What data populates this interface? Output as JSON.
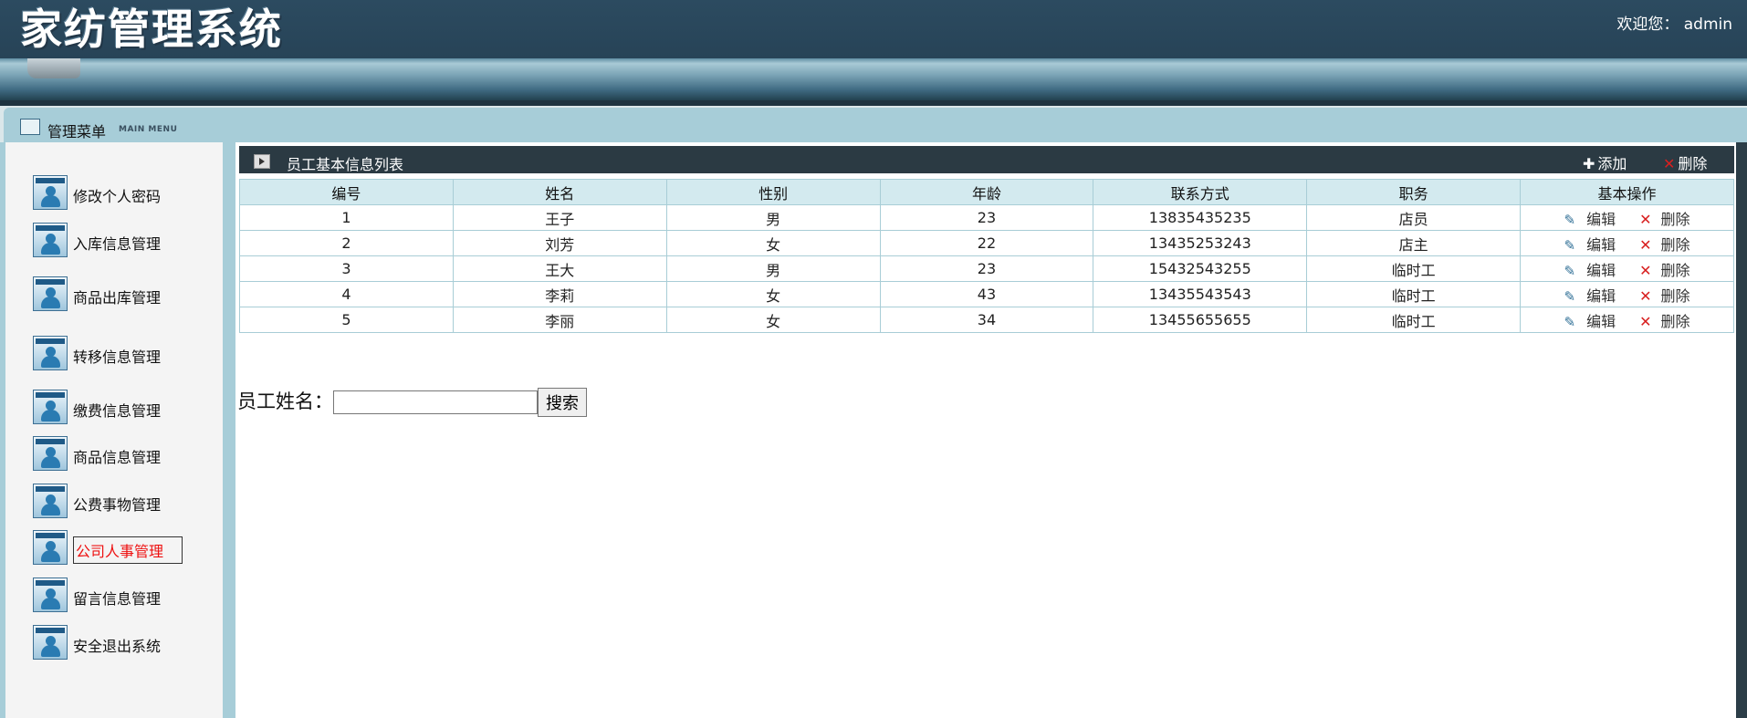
{
  "header": {
    "title": "家纺管理系统",
    "welcome": "欢迎您： admin"
  },
  "menu": {
    "title": "管理菜单",
    "subtitle": "MAIN MENU"
  },
  "sidebar": {
    "items": [
      {
        "label": "修改个人密码"
      },
      {
        "label": "入库信息管理"
      },
      {
        "label": "商品出库管理"
      },
      {
        "label": "转移信息管理"
      },
      {
        "label": "缴费信息管理"
      },
      {
        "label": "商品信息管理"
      },
      {
        "label": "公费事物管理"
      },
      {
        "label": "公司人事管理",
        "active": true
      },
      {
        "label": "留言信息管理"
      },
      {
        "label": "安全退出系统"
      }
    ]
  },
  "panel": {
    "title": "员工基本信息列表",
    "add_label": "添加",
    "delete_label": "删除"
  },
  "table": {
    "columns": [
      "编号",
      "姓名",
      "性别",
      "年龄",
      "联系方式",
      "职务",
      "基本操作"
    ],
    "rows": [
      [
        "1",
        "王子",
        "男",
        "23",
        "13835435235",
        "店员"
      ],
      [
        "2",
        "刘芳",
        "女",
        "22",
        "13435253243",
        "店主"
      ],
      [
        "3",
        "王大",
        "男",
        "23",
        "15432543255",
        "临时工"
      ],
      [
        "4",
        "李莉",
        "女",
        "43",
        "13435543543",
        "临时工"
      ],
      [
        "5",
        "李丽",
        "女",
        "34",
        "13455655655",
        "临时工"
      ]
    ],
    "edit_label": "编辑",
    "remove_label": "删除"
  },
  "search": {
    "label": "员工姓名：",
    "value": "",
    "button": "搜索"
  },
  "colors": {
    "header_bg": "#2c4b60",
    "menubar_bg": "#a7cdd8",
    "active_item": "#e11111",
    "delete_icon": "#d81f1f"
  }
}
